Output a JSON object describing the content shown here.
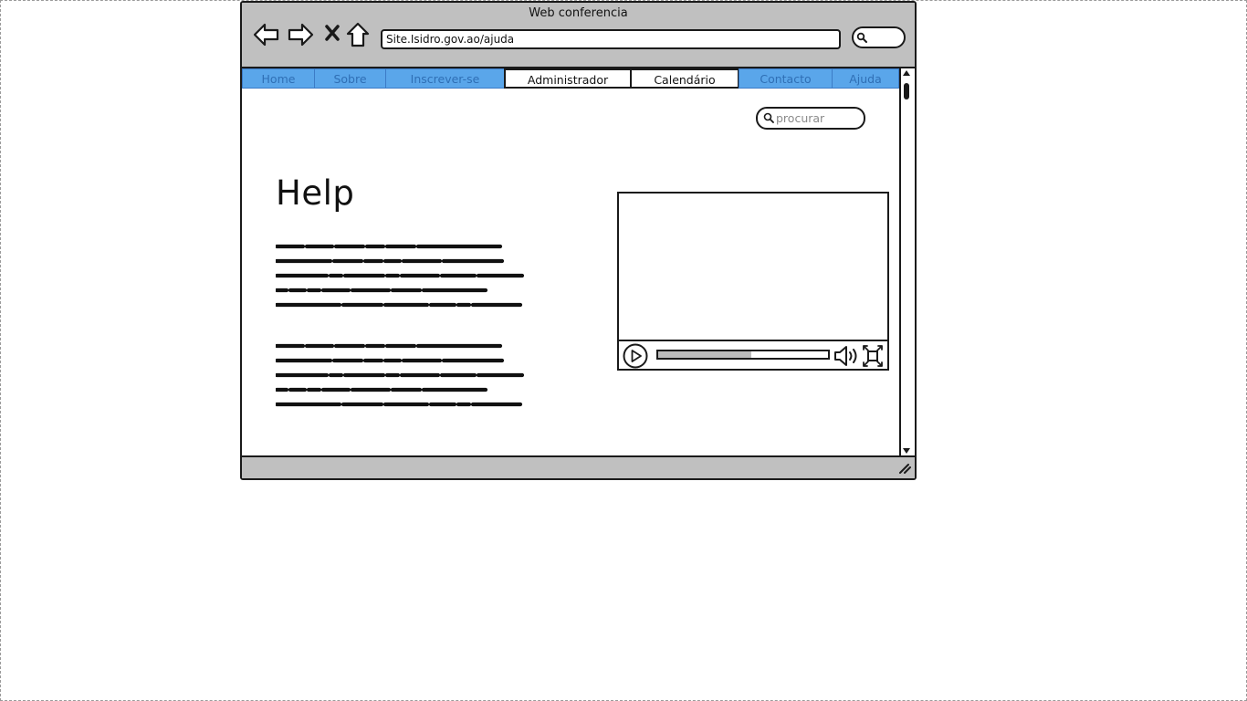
{
  "window": {
    "title": "Web conferencia"
  },
  "toolbar": {
    "icons": [
      "back-arrow-icon",
      "forward-arrow-icon",
      "stop-icon",
      "home-icon",
      "search-icon"
    ],
    "address": "Site.Isidro.gov.ao/ajuda"
  },
  "nav": {
    "tabs": [
      {
        "label": "Home",
        "state": "active"
      },
      {
        "label": "Sobre",
        "state": "active"
      },
      {
        "label": "Inscrever-se",
        "state": "active"
      },
      {
        "label": "Administrador",
        "state": "inactive"
      },
      {
        "label": "Calendário",
        "state": "inactive"
      },
      {
        "label": "Contacto",
        "state": "active"
      },
      {
        "label": "Ajuda",
        "state": "active"
      }
    ]
  },
  "search": {
    "placeholder": "procurar",
    "value": ""
  },
  "content": {
    "heading": "Help",
    "paragraphs_note": "scribbled placeholder text (unreadable)"
  },
  "video": {
    "progress": 0.55,
    "icons": [
      "play-icon",
      "volume-icon",
      "fullscreen-icon"
    ]
  },
  "colors": {
    "chrome": "#c0c0c0",
    "tab_active_bg": "#5aa6ea",
    "tab_active_text": "#2f6fb5",
    "outline": "#1a1a1a"
  }
}
